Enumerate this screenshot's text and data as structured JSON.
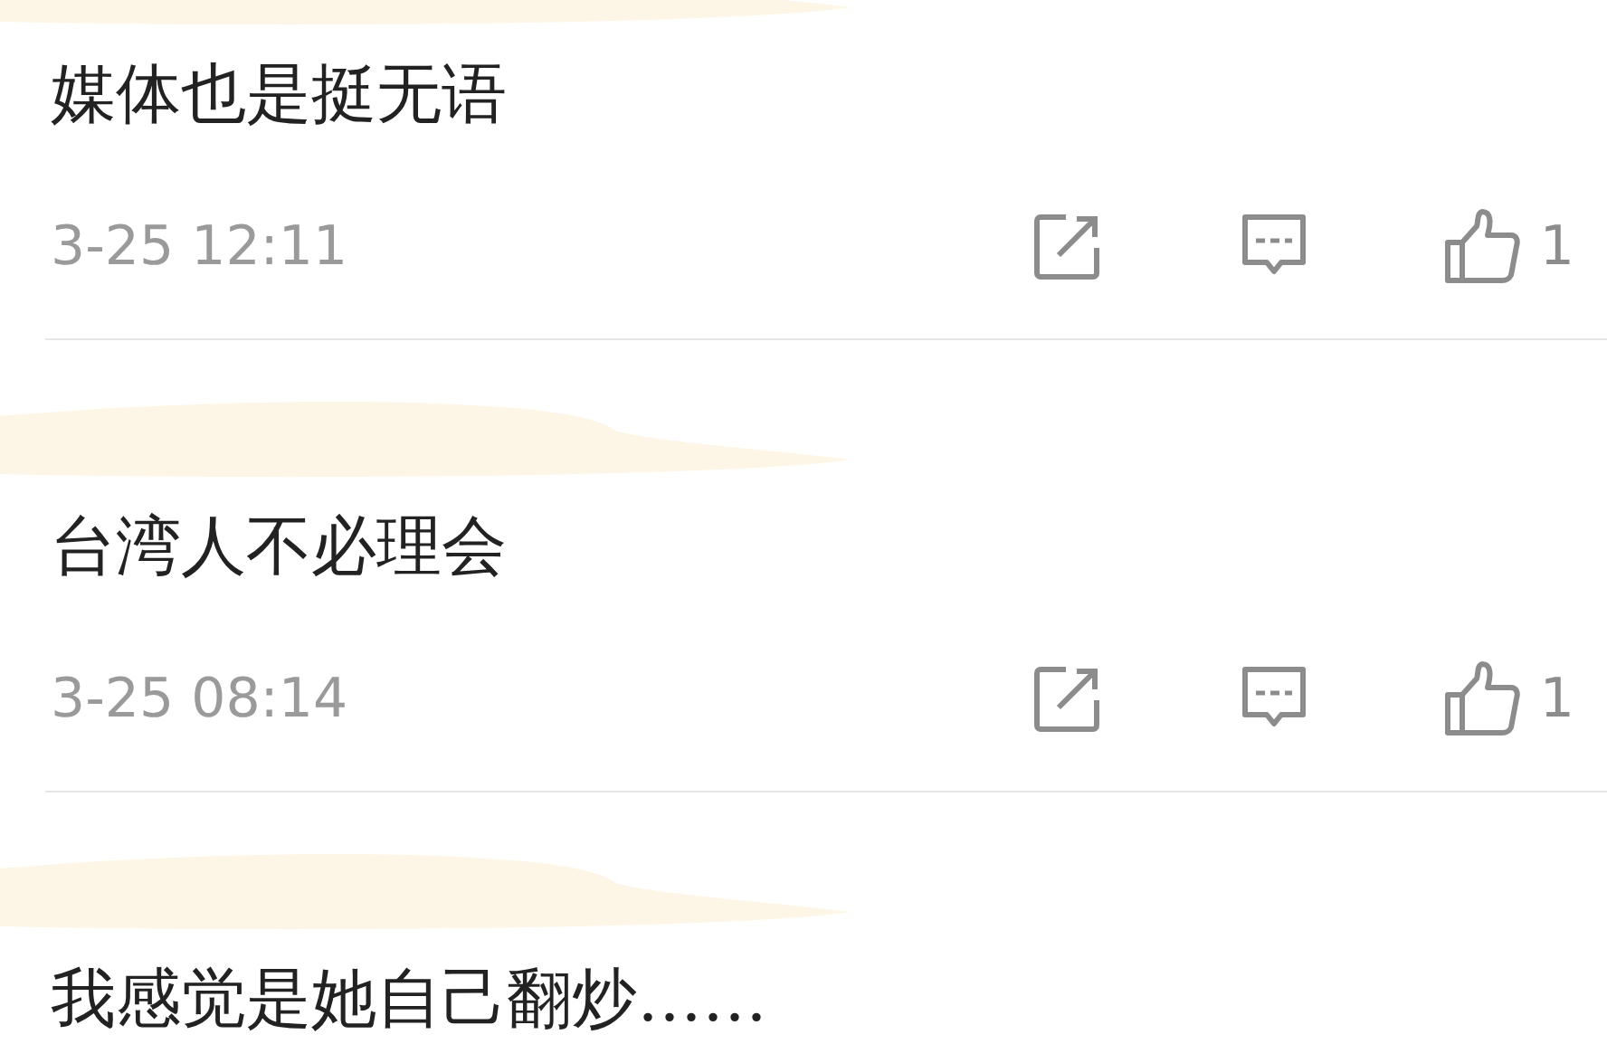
{
  "comments": [
    {
      "text": "媒体也是挺无语",
      "time": "3-25 12:11",
      "likes": "1"
    },
    {
      "text": "台湾人不必理会",
      "time": "3-25 08:14",
      "likes": "1"
    },
    {
      "text": "我感觉是她自己翻炒……"
    }
  ]
}
